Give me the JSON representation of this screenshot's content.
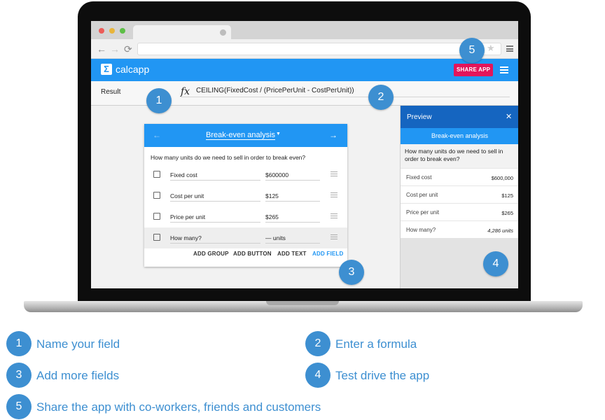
{
  "colors": {
    "accent": "#2196f3",
    "preview_header": "#1565c0",
    "share_button": "#e3155a",
    "callout": "#3d8fd1"
  },
  "browser": {
    "star_icon": "★",
    "back_icon": "←",
    "forward_icon": "→",
    "reload_icon": "C"
  },
  "app": {
    "logo_icon": "Σ",
    "name": "calcapp",
    "share_label": "SHARE APP"
  },
  "formula": {
    "label": "Result",
    "fx": "fx",
    "expression": "CEILING(FixedCost / (PricePerUnit - CostPerUnit))"
  },
  "editor": {
    "title": "Break-even analysis",
    "caret": "▼",
    "prev_icon": "←",
    "next_icon": "→",
    "question": "How many units do we need to sell in order to break even?",
    "fields": [
      {
        "name": "Fixed cost",
        "value": "$600000"
      },
      {
        "name": "Cost per unit",
        "value": "$125"
      },
      {
        "name": "Price per unit",
        "value": "$265"
      },
      {
        "name": "How many?",
        "value": "— units"
      }
    ],
    "actions": [
      "ADD GROUP",
      "ADD BUTTON",
      "ADD TEXT",
      "ADD FIELD"
    ]
  },
  "preview": {
    "title": "Preview",
    "close_icon": "✕",
    "app_title": "Break-even analysis",
    "question": "How many units do we need to sell in order to break even?",
    "rows": [
      {
        "label": "Fixed cost",
        "value": "$600,000"
      },
      {
        "label": "Cost per unit",
        "value": "$125"
      },
      {
        "label": "Price per unit",
        "value": "$265"
      },
      {
        "label": "How many?",
        "value": "4,286 units"
      }
    ]
  },
  "callouts": [
    "1",
    "2",
    "3",
    "4",
    "5"
  ],
  "legend": [
    {
      "number": "1",
      "text": "Name your field"
    },
    {
      "number": "2",
      "text": "Enter a formula"
    },
    {
      "number": "3",
      "text": "Add more fields"
    },
    {
      "number": "4",
      "text": "Test drive the app"
    },
    {
      "number": "5",
      "text": "Share the app with co-workers, friends and customers"
    }
  ]
}
